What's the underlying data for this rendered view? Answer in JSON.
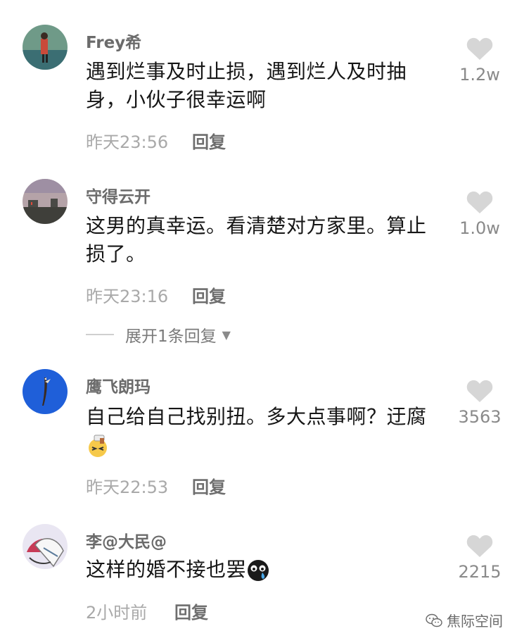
{
  "comments": [
    {
      "username": "Frey希",
      "text": "遇到烂事及时止损，遇到烂人及时抽身，小伙子很幸运啊",
      "time": "昨天23:56",
      "reply_label": "回复",
      "likes": "1.2w"
    },
    {
      "username": "守得云开",
      "text": "这男的真幸运。看清楚对方家里。算止损了。",
      "time": "昨天23:16",
      "reply_label": "回复",
      "likes": "1.0w",
      "expand_label": "展开1条回复"
    },
    {
      "username": "鹰飞朗玛",
      "text": "自己给自己找别扭。多大点事啊？迂腐",
      "time": "昨天22:53",
      "reply_label": "回复",
      "likes": "3563"
    },
    {
      "username": "李@大民@",
      "text": "这样的婚不接也罢",
      "time": "2小时前",
      "reply_label": "回复",
      "likes": "2215"
    }
  ],
  "watermark": "焦际空间",
  "icons": {
    "like": "heart-icon",
    "expand": "caret-down-icon",
    "watermark": "wechat-icon"
  },
  "colors": {
    "username": "#6b6b6b",
    "time": "#a9a9a9",
    "heart": "#d6d6d6"
  }
}
